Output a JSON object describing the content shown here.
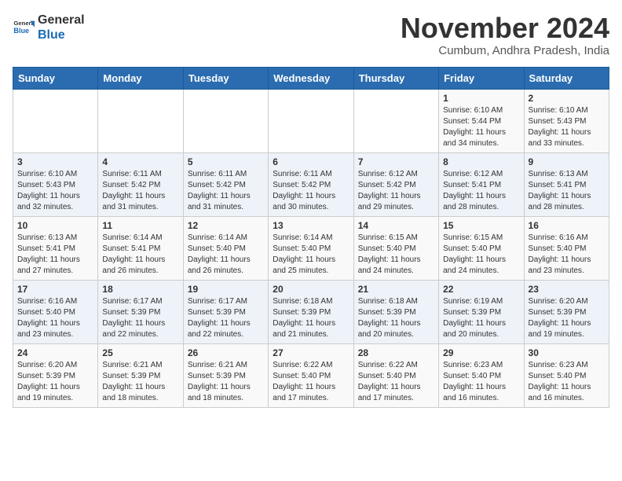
{
  "header": {
    "logo": {
      "line1": "General",
      "line2": "Blue"
    },
    "title": "November 2024",
    "location": "Cumbum, Andhra Pradesh, India"
  },
  "weekdays": [
    "Sunday",
    "Monday",
    "Tuesday",
    "Wednesday",
    "Thursday",
    "Friday",
    "Saturday"
  ],
  "weeks": [
    [
      {
        "day": "",
        "info": ""
      },
      {
        "day": "",
        "info": ""
      },
      {
        "day": "",
        "info": ""
      },
      {
        "day": "",
        "info": ""
      },
      {
        "day": "",
        "info": ""
      },
      {
        "day": "1",
        "info": "Sunrise: 6:10 AM\nSunset: 5:44 PM\nDaylight: 11 hours\nand 34 minutes."
      },
      {
        "day": "2",
        "info": "Sunrise: 6:10 AM\nSunset: 5:43 PM\nDaylight: 11 hours\nand 33 minutes."
      }
    ],
    [
      {
        "day": "3",
        "info": "Sunrise: 6:10 AM\nSunset: 5:43 PM\nDaylight: 11 hours\nand 32 minutes."
      },
      {
        "day": "4",
        "info": "Sunrise: 6:11 AM\nSunset: 5:42 PM\nDaylight: 11 hours\nand 31 minutes."
      },
      {
        "day": "5",
        "info": "Sunrise: 6:11 AM\nSunset: 5:42 PM\nDaylight: 11 hours\nand 31 minutes."
      },
      {
        "day": "6",
        "info": "Sunrise: 6:11 AM\nSunset: 5:42 PM\nDaylight: 11 hours\nand 30 minutes."
      },
      {
        "day": "7",
        "info": "Sunrise: 6:12 AM\nSunset: 5:42 PM\nDaylight: 11 hours\nand 29 minutes."
      },
      {
        "day": "8",
        "info": "Sunrise: 6:12 AM\nSunset: 5:41 PM\nDaylight: 11 hours\nand 28 minutes."
      },
      {
        "day": "9",
        "info": "Sunrise: 6:13 AM\nSunset: 5:41 PM\nDaylight: 11 hours\nand 28 minutes."
      }
    ],
    [
      {
        "day": "10",
        "info": "Sunrise: 6:13 AM\nSunset: 5:41 PM\nDaylight: 11 hours\nand 27 minutes."
      },
      {
        "day": "11",
        "info": "Sunrise: 6:14 AM\nSunset: 5:41 PM\nDaylight: 11 hours\nand 26 minutes."
      },
      {
        "day": "12",
        "info": "Sunrise: 6:14 AM\nSunset: 5:40 PM\nDaylight: 11 hours\nand 26 minutes."
      },
      {
        "day": "13",
        "info": "Sunrise: 6:14 AM\nSunset: 5:40 PM\nDaylight: 11 hours\nand 25 minutes."
      },
      {
        "day": "14",
        "info": "Sunrise: 6:15 AM\nSunset: 5:40 PM\nDaylight: 11 hours\nand 24 minutes."
      },
      {
        "day": "15",
        "info": "Sunrise: 6:15 AM\nSunset: 5:40 PM\nDaylight: 11 hours\nand 24 minutes."
      },
      {
        "day": "16",
        "info": "Sunrise: 6:16 AM\nSunset: 5:40 PM\nDaylight: 11 hours\nand 23 minutes."
      }
    ],
    [
      {
        "day": "17",
        "info": "Sunrise: 6:16 AM\nSunset: 5:40 PM\nDaylight: 11 hours\nand 23 minutes."
      },
      {
        "day": "18",
        "info": "Sunrise: 6:17 AM\nSunset: 5:39 PM\nDaylight: 11 hours\nand 22 minutes."
      },
      {
        "day": "19",
        "info": "Sunrise: 6:17 AM\nSunset: 5:39 PM\nDaylight: 11 hours\nand 22 minutes."
      },
      {
        "day": "20",
        "info": "Sunrise: 6:18 AM\nSunset: 5:39 PM\nDaylight: 11 hours\nand 21 minutes."
      },
      {
        "day": "21",
        "info": "Sunrise: 6:18 AM\nSunset: 5:39 PM\nDaylight: 11 hours\nand 20 minutes."
      },
      {
        "day": "22",
        "info": "Sunrise: 6:19 AM\nSunset: 5:39 PM\nDaylight: 11 hours\nand 20 minutes."
      },
      {
        "day": "23",
        "info": "Sunrise: 6:20 AM\nSunset: 5:39 PM\nDaylight: 11 hours\nand 19 minutes."
      }
    ],
    [
      {
        "day": "24",
        "info": "Sunrise: 6:20 AM\nSunset: 5:39 PM\nDaylight: 11 hours\nand 19 minutes."
      },
      {
        "day": "25",
        "info": "Sunrise: 6:21 AM\nSunset: 5:39 PM\nDaylight: 11 hours\nand 18 minutes."
      },
      {
        "day": "26",
        "info": "Sunrise: 6:21 AM\nSunset: 5:39 PM\nDaylight: 11 hours\nand 18 minutes."
      },
      {
        "day": "27",
        "info": "Sunrise: 6:22 AM\nSunset: 5:40 PM\nDaylight: 11 hours\nand 17 minutes."
      },
      {
        "day": "28",
        "info": "Sunrise: 6:22 AM\nSunset: 5:40 PM\nDaylight: 11 hours\nand 17 minutes."
      },
      {
        "day": "29",
        "info": "Sunrise: 6:23 AM\nSunset: 5:40 PM\nDaylight: 11 hours\nand 16 minutes."
      },
      {
        "day": "30",
        "info": "Sunrise: 6:23 AM\nSunset: 5:40 PM\nDaylight: 11 hours\nand 16 minutes."
      }
    ]
  ]
}
